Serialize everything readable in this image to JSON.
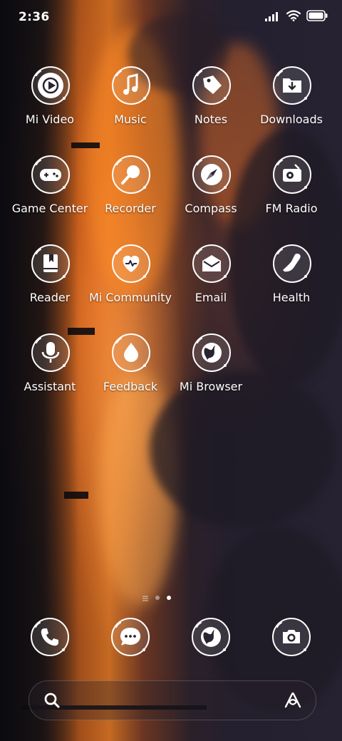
{
  "status_bar": {
    "time": "2:36"
  },
  "apps": [
    {
      "label": "Mi Video",
      "icon": "play-icon"
    },
    {
      "label": "Music",
      "icon": "music-note-icon"
    },
    {
      "label": "Notes",
      "icon": "tag-icon"
    },
    {
      "label": "Downloads",
      "icon": "download-folder-icon"
    },
    {
      "label": "Game Center",
      "icon": "gamepad-icon"
    },
    {
      "label": "Recorder",
      "icon": "microphone-icon"
    },
    {
      "label": "Compass",
      "icon": "compass-icon"
    },
    {
      "label": "FM Radio",
      "icon": "radio-icon"
    },
    {
      "label": "Reader",
      "icon": "book-icon"
    },
    {
      "label": "Mi Community",
      "icon": "heart-icon"
    },
    {
      "label": "Email",
      "icon": "envelope-icon"
    },
    {
      "label": "Health",
      "icon": "shoe-icon"
    },
    {
      "label": "Assistant",
      "icon": "assistant-mic-icon"
    },
    {
      "label": "Feedback",
      "icon": "drop-icon"
    },
    {
      "label": "Mi Browser",
      "icon": "globe-icon"
    }
  ],
  "pager": {
    "pages": 3,
    "active": 2
  },
  "dock": [
    {
      "icon": "phone-icon"
    },
    {
      "icon": "messages-icon"
    },
    {
      "icon": "browser-globe-icon"
    },
    {
      "icon": "camera-icon"
    }
  ],
  "colors": {
    "icon_fill": "#ffffff",
    "icon_glyph": "#2a2430",
    "text": "#ffffff"
  }
}
